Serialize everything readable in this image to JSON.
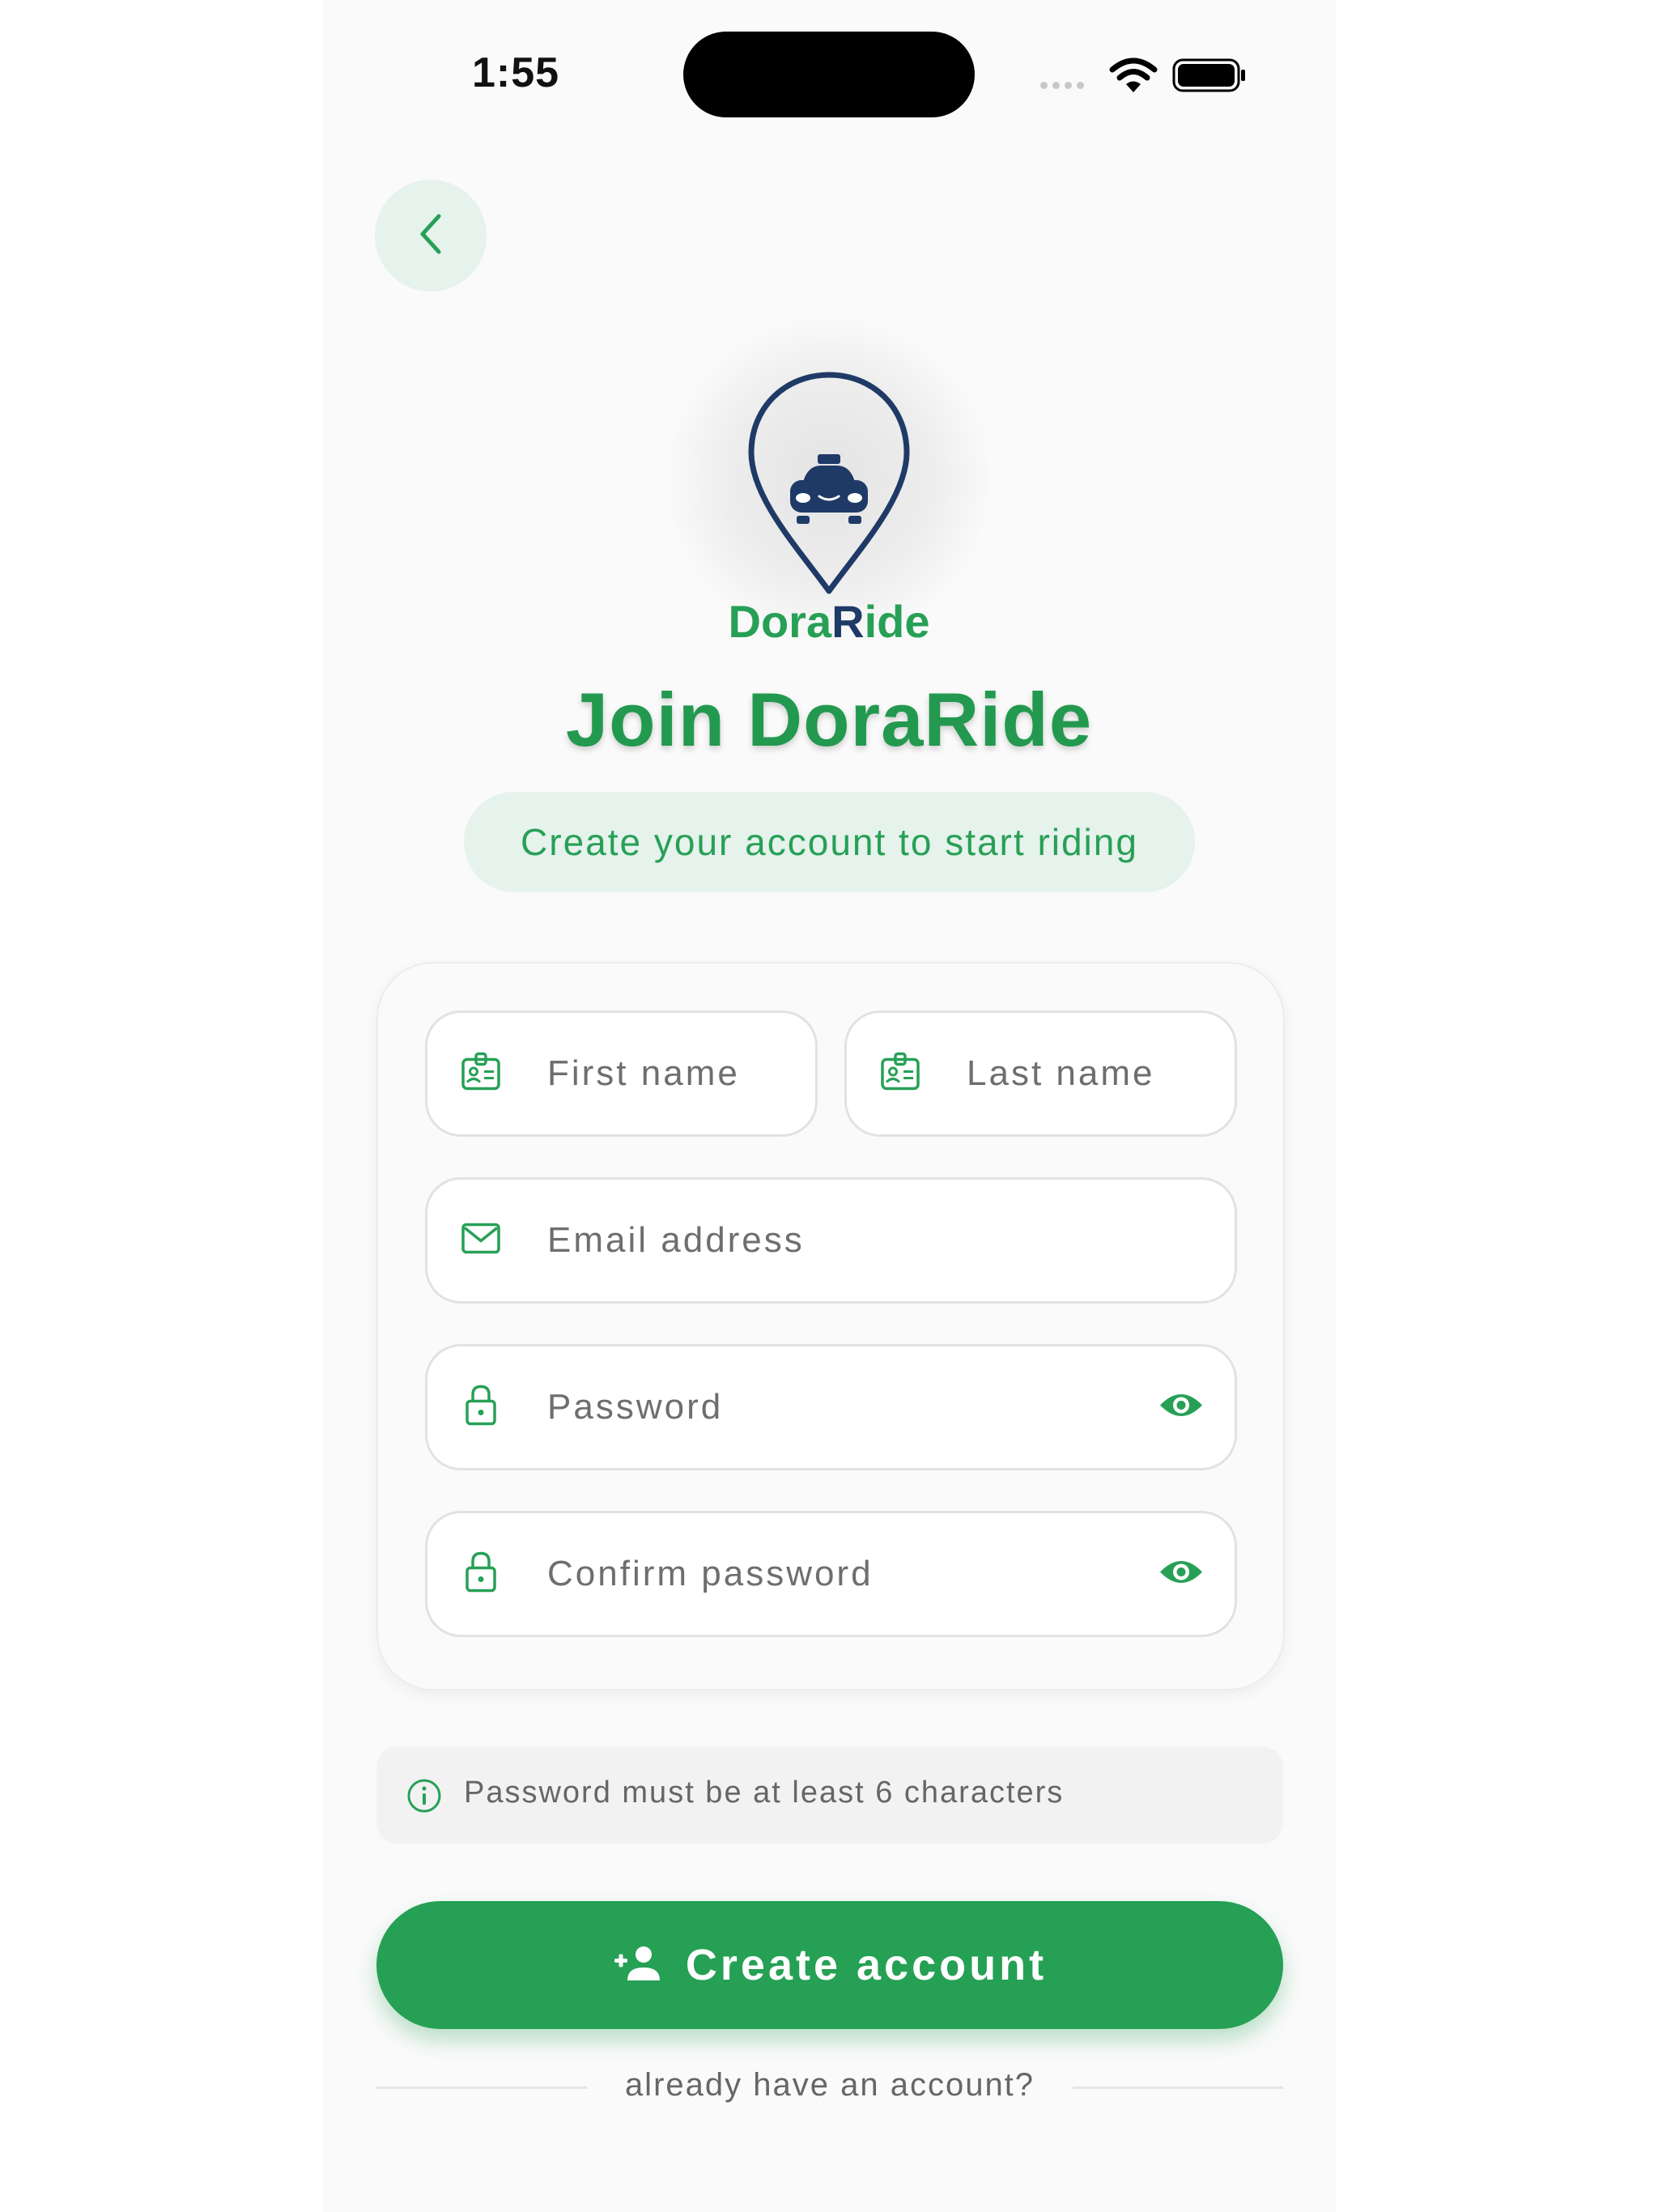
{
  "status_bar": {
    "time": "1:55"
  },
  "icons": {
    "back": "chevron-left-icon",
    "first_name": "id-card-icon",
    "last_name": "id-card-icon",
    "email": "mail-icon",
    "password": "lock-icon",
    "confirm_password": "lock-icon",
    "visibility": "eye-icon",
    "info": "info-icon",
    "create_account": "person-add-icon"
  },
  "brand": {
    "name_part1": "Dora",
    "name_r": "R",
    "name_part2": "ide"
  },
  "header": {
    "title": "Join DoraRide",
    "subtitle": "Create your account to start riding"
  },
  "form": {
    "first_name_placeholder": "First name",
    "last_name_placeholder": "Last name",
    "email_placeholder": "Email address",
    "password_placeholder": "Password",
    "confirm_password_placeholder": "Confirm password"
  },
  "hint": {
    "text": "Password must be at least 6 characters"
  },
  "actions": {
    "create_account_label": "Create account",
    "already_have_account": "already have an account?"
  },
  "colors": {
    "primary_green": "#25a054",
    "light_green": "#e6f2ec",
    "navy": "#1f3a66"
  }
}
